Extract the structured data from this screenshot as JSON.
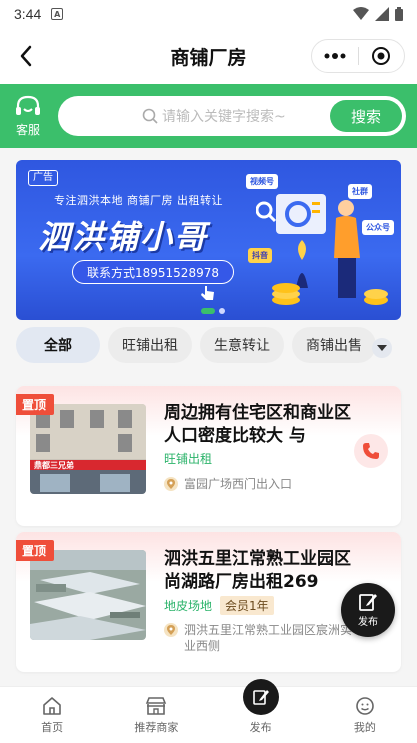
{
  "status": {
    "time": "3:44"
  },
  "nav": {
    "title": "商铺厂房"
  },
  "header": {
    "service_label": "客服",
    "search_placeholder": "请输入关键字搜索~",
    "search_button": "搜索"
  },
  "banner": {
    "ad_label": "广告",
    "tagline": "专注泗洪本地  商铺厂房  出租转让",
    "title": "泗洪铺小哥",
    "contact": "联系方式18951528978",
    "tags": [
      "视频号",
      "社群",
      "公众号",
      "抖音"
    ]
  },
  "categories": {
    "items": [
      "全部",
      "旺铺出租",
      "生意转让",
      "商铺出售"
    ],
    "active": "全部"
  },
  "listings": [
    {
      "badge": "置顶",
      "title": "周边拥有住宅区和商业区 人口密度比较大 与",
      "category": "旺铺出租",
      "member": "",
      "address": "富园广场西门出入口",
      "shop_sign": "鼎都三兄弟"
    },
    {
      "badge": "置顶",
      "title": "泗洪五里江常熟工业园区尚湖路厂房出租269",
      "category": "地皮场地",
      "member": "会员1年",
      "address": "泗洪五里江常熟工业园区宸洲实业西侧"
    }
  ],
  "fab": {
    "label": "发布"
  },
  "tabs": [
    {
      "label": "首页",
      "icon": "home-icon"
    },
    {
      "label": "推荐商家",
      "icon": "store-icon"
    },
    {
      "label": "发布",
      "icon": "edit-icon"
    },
    {
      "label": "我的",
      "icon": "user-icon"
    }
  ],
  "colors": {
    "brand_green": "#3bbf6b",
    "badge_red": "#ef4e3a",
    "banner_blue": "#2f57e0"
  }
}
